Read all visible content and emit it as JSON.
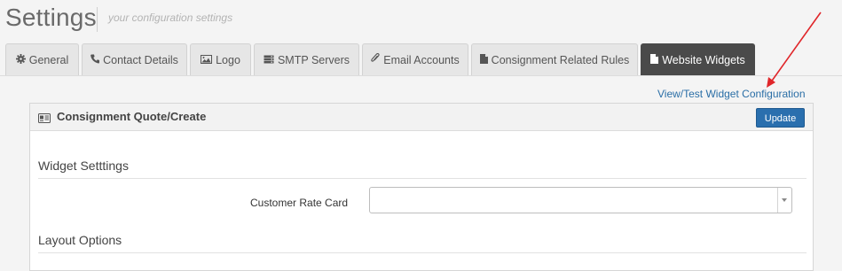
{
  "header": {
    "title": "Settings",
    "subtitle": "your configuration settings"
  },
  "tabs": [
    {
      "label": "General",
      "icon": "gear-icon",
      "active": false
    },
    {
      "label": "Contact Details",
      "icon": "phone-icon",
      "active": false
    },
    {
      "label": "Logo",
      "icon": "image-icon",
      "active": false
    },
    {
      "label": "SMTP Servers",
      "icon": "server-icon",
      "active": false
    },
    {
      "label": "Email Accounts",
      "icon": "paperclip-icon",
      "active": false
    },
    {
      "label": "Consignment Related Rules",
      "icon": "document-icon",
      "active": false
    },
    {
      "label": "Website Widgets",
      "icon": "document-icon",
      "active": true
    }
  ],
  "links": {
    "view_test": "View/Test Widget Configuration"
  },
  "panel": {
    "title": "Consignment Quote/Create",
    "icon": "id-card-icon",
    "update_label": "Update",
    "sections": {
      "widget_settings": "Widget Setttings",
      "layout_options": "Layout Options"
    },
    "fields": {
      "customer_rate_card": {
        "label": "Customer Rate Card",
        "value": ""
      }
    }
  },
  "colors": {
    "active_tab": "#4a4a4a",
    "link": "#2a6ea6",
    "update_button": "#2a6fae",
    "annotation_arrow": "#e0262a"
  }
}
